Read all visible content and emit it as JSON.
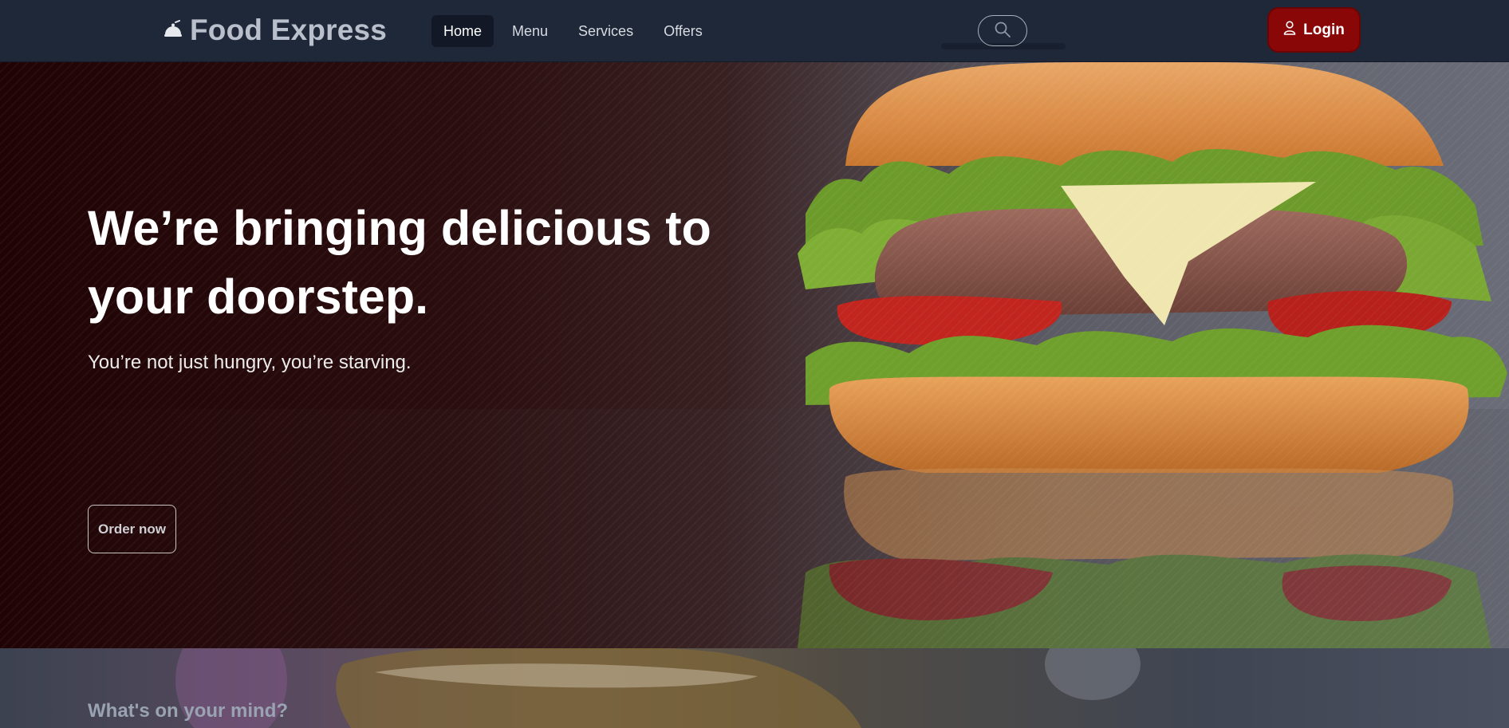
{
  "navbar": {
    "brand": "Food Express",
    "links": [
      "Home",
      "Menu",
      "Services",
      "Offers"
    ],
    "active_link": "Home",
    "search_icon": "search-icon",
    "login_label": "Login",
    "login_icon": "user-icon"
  },
  "hero": {
    "title": "We’re bringing delicious to your doorstep.",
    "subtitle": "You’re not just hungry, you’re starving.",
    "cta_label": "Order now",
    "image": "burger-photo"
  },
  "section": {
    "title": "What's on your mind?"
  },
  "colors": {
    "navbar_bg": "#1f2838",
    "login_bg": "#8a0708",
    "hero_dark": "#200405"
  }
}
